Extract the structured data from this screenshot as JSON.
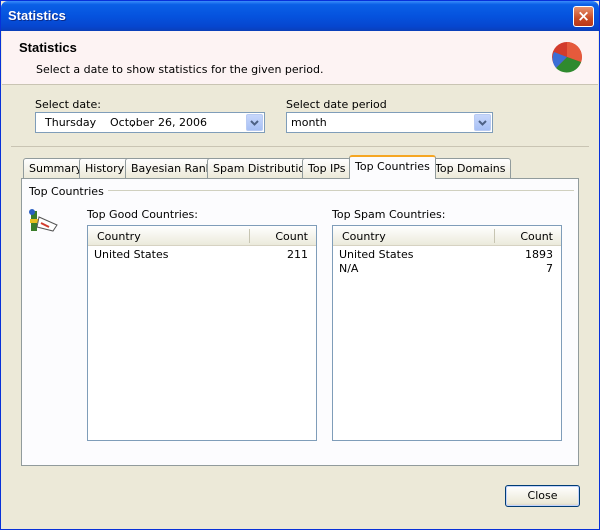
{
  "window": {
    "title": "Statistics"
  },
  "header": {
    "title": "Statistics",
    "subtitle": "Select a date to show statistics for the given period."
  },
  "date": {
    "label": "Select date:",
    "day": "Thursday",
    "sep": ",",
    "month": "October",
    "daynum": "26,",
    "year": "2006"
  },
  "period": {
    "label": "Select date period",
    "value": "month"
  },
  "tabs": [
    {
      "label": "Summary"
    },
    {
      "label": "History"
    },
    {
      "label": "Bayesian Rank"
    },
    {
      "label": "Spam Distribution"
    },
    {
      "label": "Top IPs"
    },
    {
      "label": "Top Countries"
    },
    {
      "label": "Top Domains"
    }
  ],
  "group": {
    "title": "Top Countries"
  },
  "good": {
    "label": "Top Good Countries:",
    "col_country": "Country",
    "col_count": "Count",
    "rows": [
      {
        "country": "United States",
        "count": "211"
      }
    ]
  },
  "spam": {
    "label": "Top Spam Countries:",
    "col_country": "Country",
    "col_count": "Count",
    "rows": [
      {
        "country": "United States",
        "count": "1893"
      },
      {
        "country": "N/A",
        "count": "7"
      }
    ]
  },
  "footer": {
    "close_label": "Close"
  },
  "colors": {
    "title_bar": "#0553de",
    "header_bg": "#fdf3f3",
    "tab_highlight": "#f5a623",
    "face": "#ece9d8"
  }
}
